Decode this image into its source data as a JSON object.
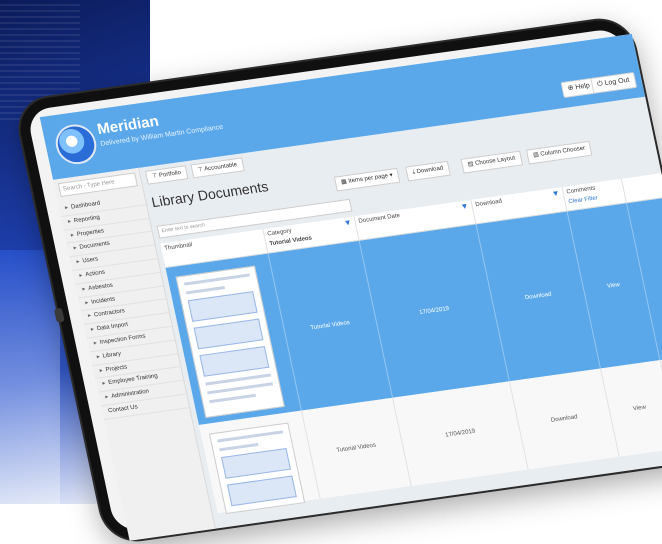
{
  "header": {
    "app_name": "Meridian",
    "powered_by": "Delivered by William Martin Compliance",
    "help_label": "Help",
    "logout_label": "Log Out"
  },
  "sidebar": {
    "search_placeholder": "Search - Type Here",
    "items": [
      {
        "label": "Dashboard"
      },
      {
        "label": "Reporting"
      },
      {
        "label": "Properties"
      },
      {
        "label": "Documents"
      },
      {
        "label": "Users"
      },
      {
        "label": "Actions"
      },
      {
        "label": "Asbestos"
      },
      {
        "label": "Incidents"
      },
      {
        "label": "Contractors"
      },
      {
        "label": "Data Import"
      },
      {
        "label": "Inspection Forms"
      },
      {
        "label": "Library"
      },
      {
        "label": "Projects"
      },
      {
        "label": "Employee Training"
      },
      {
        "label": "Administration"
      },
      {
        "label": "Contact Us"
      }
    ]
  },
  "toolbar": {
    "portfolio_label": "Portfolio",
    "accountable_label": "Accountable"
  },
  "main": {
    "title": "Library Documents",
    "items_per_page_label": "Items per page",
    "download_label": "Download",
    "choose_layout_label": "Choose Layout",
    "column_chooser_label": "Column Chooser",
    "search_all_placeholder": "Enter text to search"
  },
  "grid": {
    "columns": [
      "Thumbnail",
      "Category",
      "Document Date",
      "Download",
      "Comments"
    ],
    "category_filter_value": "Tutorial Videos",
    "clear_filter_label": "Clear Filter",
    "rows": [
      {
        "category": "Tutorial Videos",
        "date": "17/04/2019",
        "download": "Download",
        "view": "View"
      },
      {
        "category": "Tutorial Videos",
        "date": "17/04/2019",
        "download": "Download",
        "view": "View"
      }
    ]
  },
  "colors": {
    "accent_blue": "#5aa8ea",
    "link_blue": "#2f78d6"
  }
}
